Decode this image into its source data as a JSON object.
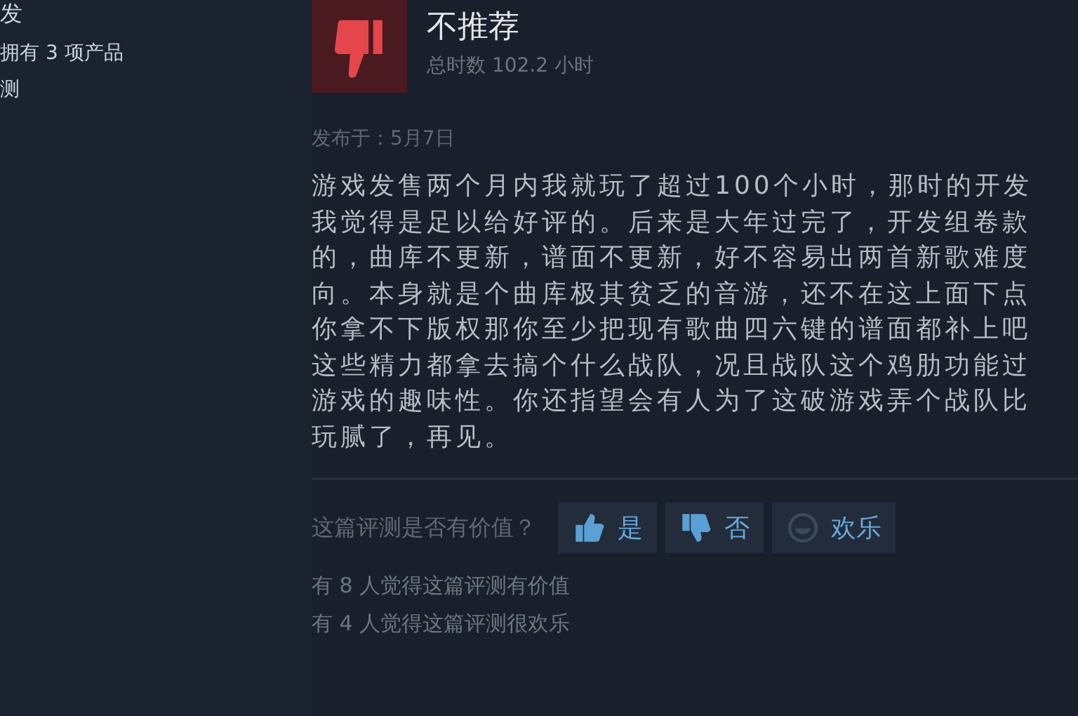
{
  "sidebar": {
    "lines": [
      "发",
      "拥有 3 项产品",
      "测"
    ]
  },
  "review": {
    "recommended": false,
    "verdict": "不推荐",
    "hours": "总时数 102.2 小时",
    "date": "发布于：5月7日",
    "lines": [
      "游戏发售两个月内我就玩了超过100个小时，那时的开发",
      "我觉得是足以给好评的。后来是大年过完了，开发组卷款",
      "的，曲库不更新，谱面不更新，好不容易出两首新歌难度",
      "向。本身就是个曲库极其贫乏的音游，还不在这上面下点",
      "你拿不下版权那你至少把现有歌曲四六键的谱面都补上吧",
      "这些精力都拿去搞个什么战队，况且战队这个鸡肋功能过",
      "游戏的趣味性。你还指望会有人为了这破游戏弄个战队比",
      "玩腻了，再见。"
    ]
  },
  "helpful": {
    "prompt": "这篇评测是否有价值？",
    "buttons": [
      {
        "kind": "yes",
        "label": "是"
      },
      {
        "kind": "no",
        "label": "否"
      },
      {
        "kind": "funny",
        "label": "欢乐"
      }
    ],
    "counts": [
      "有 8 人觉得这篇评测有价值",
      "有 4 人觉得这篇评测很欢乐"
    ]
  }
}
